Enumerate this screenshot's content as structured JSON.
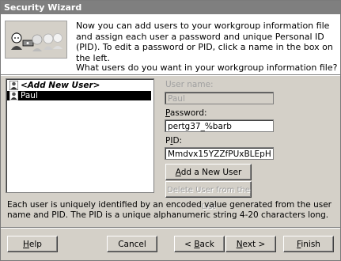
{
  "window": {
    "title": "Security Wizard"
  },
  "header": {
    "intro_text": "Now you can add users to your workgroup information file and assign each user a password and unique Personal ID (PID). To edit a password or PID, click a name in the box on the left.",
    "question": "What users do you want in your workgroup information file?"
  },
  "user_list": {
    "items": [
      {
        "label": "<Add New User>",
        "bold": true,
        "selected": false
      },
      {
        "label": "Paul",
        "bold": false,
        "selected": true
      }
    ]
  },
  "form": {
    "username_label": "User name:",
    "username_value": "Paul",
    "password_label": "Password:",
    "password_value": "pertg37_%barb",
    "pid_label": "PID:",
    "pid_value": "Mmdvx15YZZfPUxBLEpH",
    "add_button": "Add a New User",
    "delete_button": "Delete User from the List"
  },
  "footer": {
    "info_text": "Each user is uniquely identified by an encoded value generated from the user name and PID. The PID is a unique alphanumeric string 4-20 characters long."
  },
  "buttons": {
    "help": "Help",
    "cancel": "Cancel",
    "back": "< Back",
    "next": "Next >",
    "finish": "Finish"
  }
}
